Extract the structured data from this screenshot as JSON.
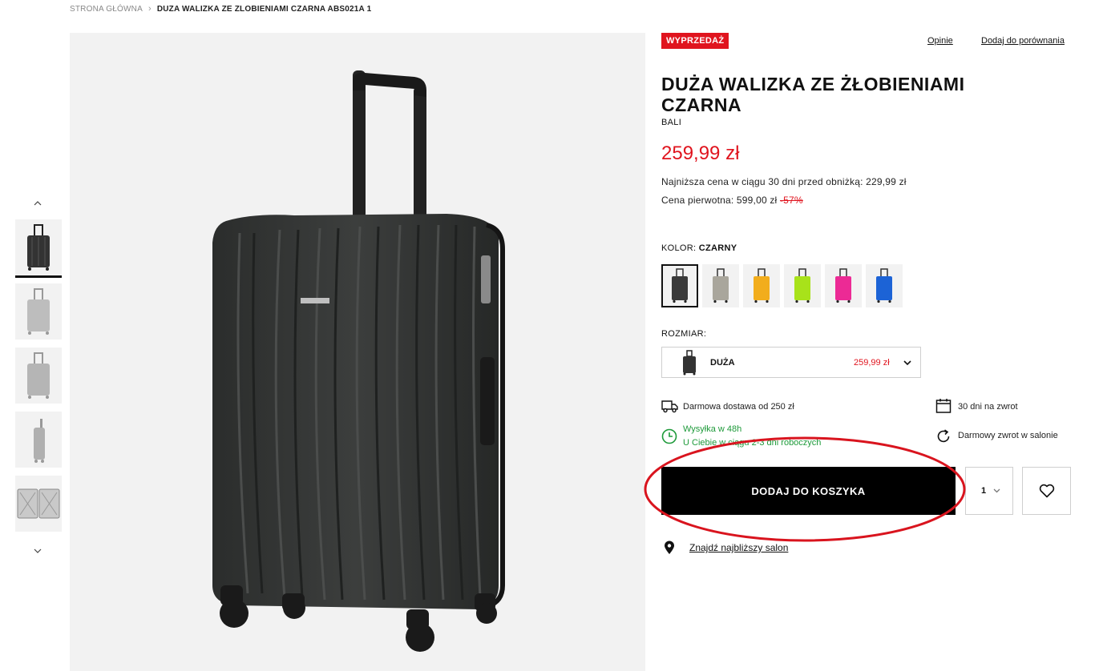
{
  "breadcrumb": {
    "home": "STRONA GŁÓWNA",
    "separator": "›",
    "current": "DUZA WALIZKA ZE ZLOBIENIAMI CZARNA ABS021A 1"
  },
  "badge": "WYPRZEDAŻ",
  "links": {
    "reviews": "Opinie",
    "compare": "Dodaj do porównania",
    "store": "Znajdź najbliższy salon"
  },
  "product": {
    "title": "DUŻA WALIZKA ZE ŻŁOBIENIAMI CZARNA",
    "brand": "BALI",
    "price": "259,99 zł",
    "lowest_price_label": "Najniższa cena w ciągu 30 dni przed obniżką: 229,99 zł",
    "original_label": "Cena pierwotna: 599,00 zł",
    "discount": "-57%"
  },
  "color": {
    "label": "KOLOR:",
    "selected": "CZARNY",
    "swatches": [
      {
        "name": "czarny",
        "hex": "#3a3a3a"
      },
      {
        "name": "szary",
        "hex": "#a9a69c"
      },
      {
        "name": "żółty",
        "hex": "#f2ad1c"
      },
      {
        "name": "limonkowy",
        "hex": "#a8e21a"
      },
      {
        "name": "różowy",
        "hex": "#ec2a95"
      },
      {
        "name": "niebieski",
        "hex": "#1c63d6"
      }
    ]
  },
  "size": {
    "label": "ROZMIAR:",
    "selected": "DUŻA",
    "price": "259,99 zł"
  },
  "features": {
    "delivery": "Darmowa dostawa od 250 zł",
    "returns": "30 dni na zwrot",
    "shipping_title": "Wysyłka w 48h",
    "shipping_sub": "U Ciebie w ciągu 2-3 dni roboczych",
    "store_return": "Darmowy zwrot w salonie"
  },
  "cart": {
    "button": "DODAJ DO KOSZYKA",
    "quantity": "1"
  },
  "icons": {
    "truck": "truck-icon",
    "calendar": "calendar-icon",
    "clock": "clock-icon",
    "refresh": "refresh-icon",
    "heart": "heart-icon",
    "pin": "location-pin-icon"
  },
  "colors": {
    "accent": "#e0141e",
    "success": "#1e9a3a",
    "annotation": "#d9141e"
  }
}
